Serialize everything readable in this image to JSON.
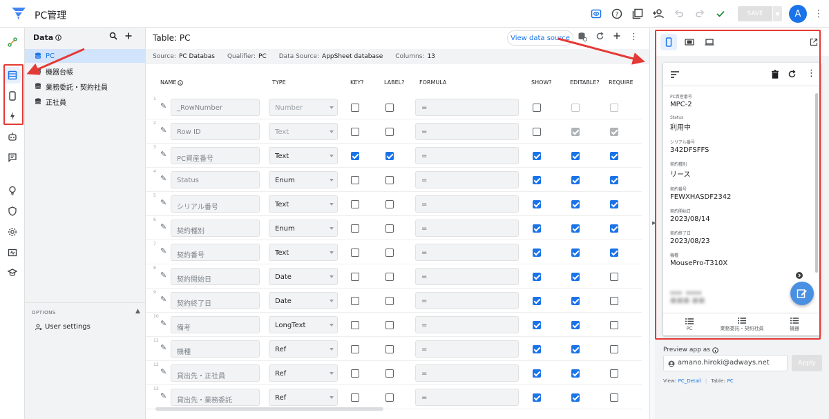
{
  "app": {
    "title": "PC管理",
    "avatar_letter": "A",
    "save_label": "SAVE"
  },
  "data_panel": {
    "title": "Data",
    "items": [
      {
        "label": "PC"
      },
      {
        "label": "機器台帳"
      },
      {
        "label": "業務委託・契約社員"
      },
      {
        "label": "正社員"
      }
    ],
    "options_label": "OPTIONS",
    "user_settings": "User settings"
  },
  "table": {
    "title": "Table: PC",
    "view_source": "View data source",
    "source": {
      "source_label": "Source:",
      "source_value": "PC Databas",
      "qualifier_label": "Qualifier:",
      "qualifier_value": "PC",
      "ds_label": "Data Source:",
      "ds_value": "AppSheet database",
      "cols_label": "Columns:",
      "cols_value": "13"
    },
    "headers": {
      "name": "NAME",
      "type": "TYPE",
      "key": "KEY?",
      "label": "LABEL?",
      "formula": "FORMULA",
      "show": "SHOW?",
      "editable": "EDITABLE?",
      "require": "REQUIRE"
    },
    "rows": [
      {
        "num": "1",
        "name": "_RowNumber",
        "type": "Number",
        "formula": "=",
        "key": false,
        "label": false,
        "show": false,
        "editable": false,
        "require": false,
        "sys": true
      },
      {
        "num": "2",
        "name": "Row ID",
        "type": "Text",
        "formula": "=",
        "key": false,
        "label": false,
        "show": false,
        "editable": true,
        "require": true,
        "sys": true
      },
      {
        "num": "3",
        "name": "PC資産番号",
        "type": "Text",
        "formula": "=",
        "key": true,
        "label": true,
        "show": true,
        "editable": true,
        "require": true
      },
      {
        "num": "4",
        "name": "Status",
        "type": "Enum",
        "formula": "=",
        "key": false,
        "label": false,
        "show": true,
        "editable": true,
        "require": true
      },
      {
        "num": "5",
        "name": "シリアル番号",
        "type": "Text",
        "formula": "=",
        "key": false,
        "label": false,
        "show": true,
        "editable": true,
        "require": true
      },
      {
        "num": "6",
        "name": "契約種別",
        "type": "Enum",
        "formula": "=",
        "key": false,
        "label": false,
        "show": true,
        "editable": true,
        "require": true
      },
      {
        "num": "7",
        "name": "契約番号",
        "type": "Text",
        "formula": "=",
        "key": false,
        "label": false,
        "show": true,
        "editable": true,
        "require": true
      },
      {
        "num": "8",
        "name": "契約開始日",
        "type": "Date",
        "formula": "=",
        "key": false,
        "label": false,
        "show": true,
        "editable": true,
        "require": false
      },
      {
        "num": "9",
        "name": "契約終了日",
        "type": "Date",
        "formula": "=",
        "key": false,
        "label": false,
        "show": true,
        "editable": true,
        "require": false
      },
      {
        "num": "10",
        "name": "備考",
        "type": "LongText",
        "formula": "=",
        "key": false,
        "label": false,
        "show": true,
        "editable": true,
        "require": false
      },
      {
        "num": "11",
        "name": "機種",
        "type": "Ref",
        "formula": "=",
        "key": false,
        "label": false,
        "show": true,
        "editable": true,
        "require": false
      },
      {
        "num": "12",
        "name": "貸出先・正社員",
        "type": "Ref",
        "formula": "=",
        "key": false,
        "label": false,
        "show": true,
        "editable": true,
        "require": false
      },
      {
        "num": "13",
        "name": "貸出先・業務委託",
        "type": "Ref",
        "formula": "=",
        "key": false,
        "label": false,
        "show": true,
        "editable": true,
        "require": false
      }
    ]
  },
  "preview": {
    "fields": [
      {
        "label": "PC資産番号",
        "value": "MPC-2"
      },
      {
        "label": "Status",
        "value": "利用中"
      },
      {
        "label": "シリアル番号",
        "value": "342DFSFFS"
      },
      {
        "label": "契約種別",
        "value": "リース"
      },
      {
        "label": "契約番号",
        "value": "FEWXHASDF2342"
      },
      {
        "label": "契約開始日",
        "value": "2023/08/14"
      },
      {
        "label": "契約終了日",
        "value": "2023/08/23"
      },
      {
        "label": "機種",
        "value": "MousePro-T310X"
      }
    ],
    "nav": [
      {
        "label": "PC"
      },
      {
        "label": "業務委託・契約社員"
      },
      {
        "label": "機器"
      }
    ],
    "preview_as": "Preview app as",
    "email": "amano.hiroki@adways.net",
    "apply": "Apply",
    "view_label": "View:",
    "view_value": "PC_Detail",
    "table_label": "Table:",
    "table_value": "PC"
  },
  "colors": {
    "accent": "#1a73e8",
    "annotation": "#e53935"
  }
}
